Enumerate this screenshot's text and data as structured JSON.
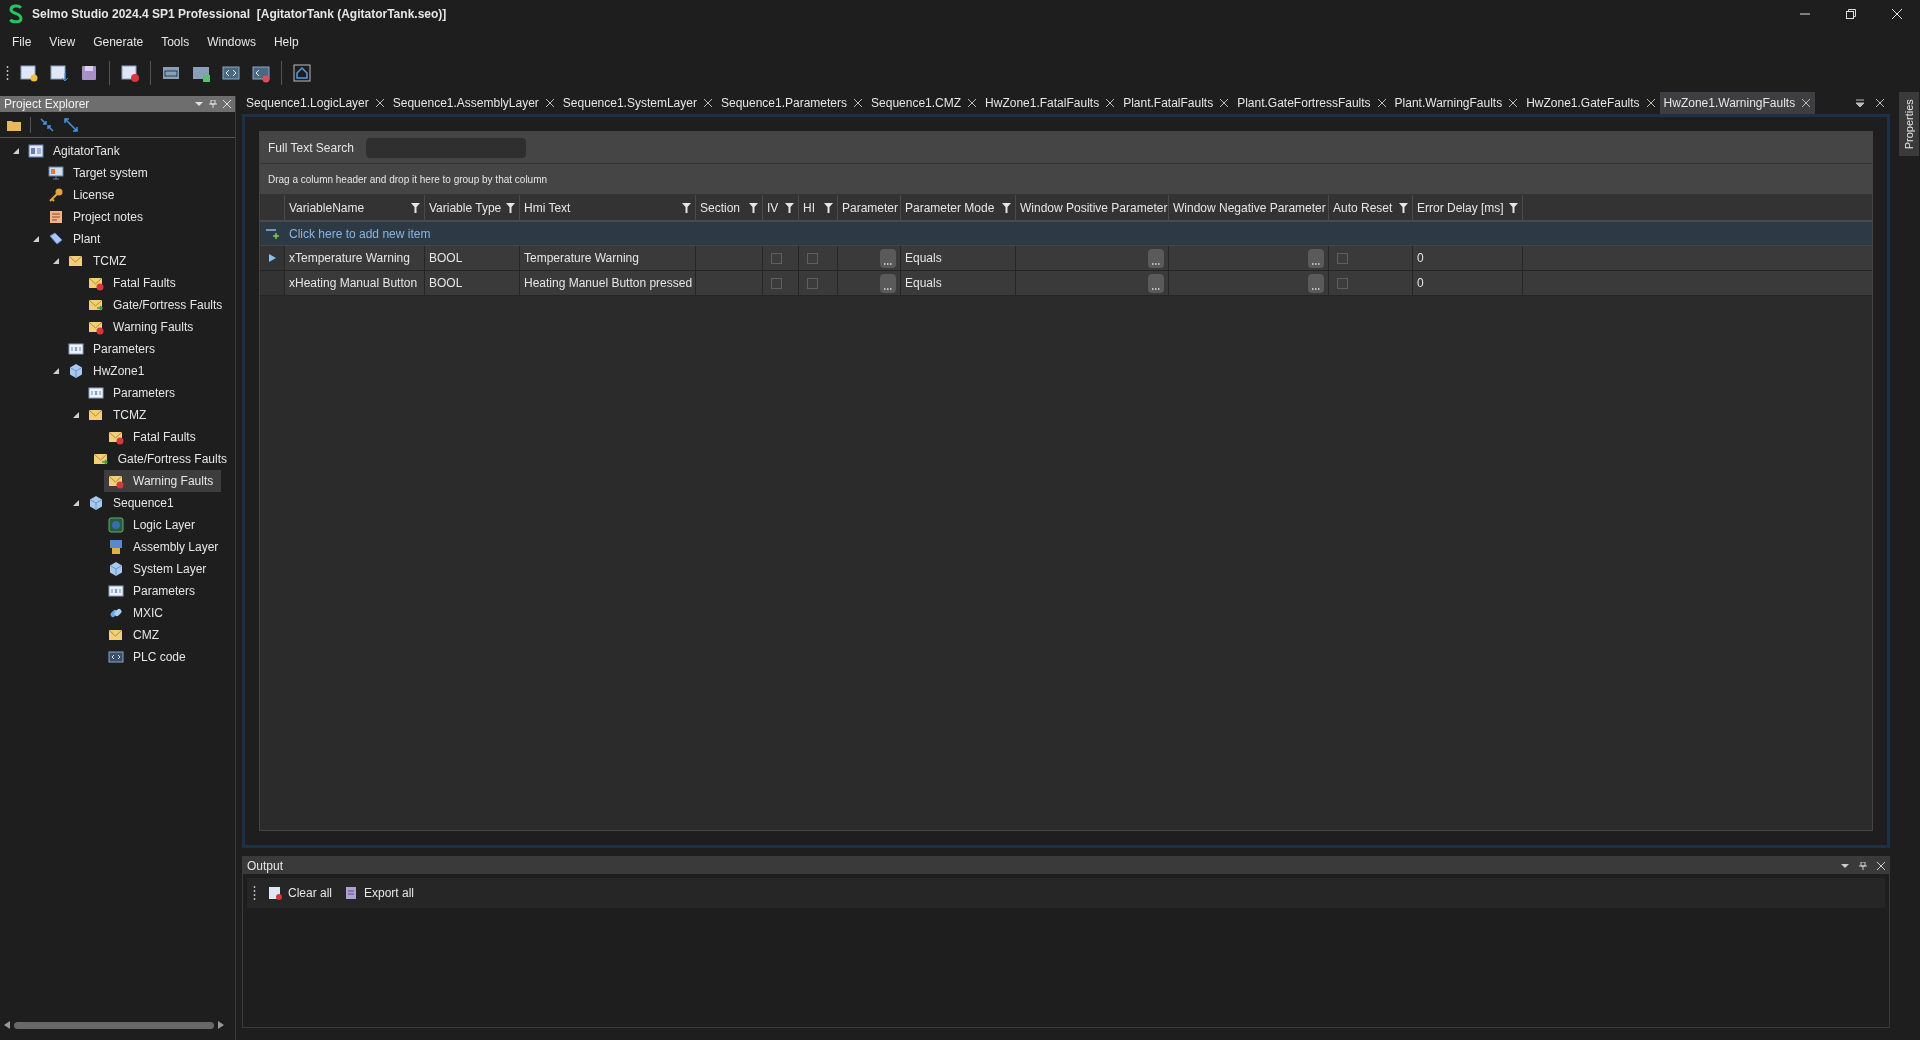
{
  "window": {
    "title": "Selmo Studio 2024.4 SP1 Professional  [AgitatorTank (AgitatorTank.seo)]"
  },
  "menu": [
    "File",
    "View",
    "Generate",
    "Tools",
    "Windows",
    "Help"
  ],
  "project_explorer": {
    "title": "Project Explorer",
    "tree": [
      {
        "label": "AgitatorTank",
        "kind": "project",
        "expanded": true,
        "selected": false,
        "children": [
          {
            "label": "Target system",
            "kind": "monitor",
            "selected": false
          },
          {
            "label": "License",
            "kind": "key",
            "selected": false
          },
          {
            "label": "Project notes",
            "kind": "notes",
            "selected": false
          },
          {
            "label": "Plant",
            "kind": "plant",
            "expanded": true,
            "selected": false,
            "children": [
              {
                "label": "TCMZ",
                "kind": "folder",
                "expanded": true,
                "selected": false,
                "children": [
                  {
                    "label": "Fatal Faults",
                    "kind": "fatal",
                    "selected": false
                  },
                  {
                    "label": "Gate/Fortress Faults",
                    "kind": "gate",
                    "selected": false
                  },
                  {
                    "label": "Warning Faults",
                    "kind": "warning",
                    "selected": false
                  }
                ]
              },
              {
                "label": "Parameters",
                "kind": "params",
                "selected": false
              },
              {
                "label": "HwZone1",
                "kind": "zone",
                "expanded": true,
                "selected": false,
                "children": [
                  {
                    "label": "Parameters",
                    "kind": "params",
                    "selected": false
                  },
                  {
                    "label": "TCMZ",
                    "kind": "folder",
                    "expanded": true,
                    "selected": false,
                    "children": [
                      {
                        "label": "Fatal Faults",
                        "kind": "fatal",
                        "selected": false
                      },
                      {
                        "label": "Gate/Fortress Faults",
                        "kind": "gate",
                        "selected": false
                      },
                      {
                        "label": "Warning Faults",
                        "kind": "warning",
                        "selected": true
                      }
                    ]
                  },
                  {
                    "label": "Sequence1",
                    "kind": "cube",
                    "expanded": true,
                    "selected": false,
                    "children": [
                      {
                        "label": "Logic Layer",
                        "kind": "logic",
                        "selected": false
                      },
                      {
                        "label": "Assembly Layer",
                        "kind": "assembly",
                        "selected": false
                      },
                      {
                        "label": "System Layer",
                        "kind": "cube",
                        "selected": false
                      },
                      {
                        "label": "Parameters",
                        "kind": "params",
                        "selected": false
                      },
                      {
                        "label": "MXIC",
                        "kind": "mxic",
                        "selected": false
                      },
                      {
                        "label": "CMZ",
                        "kind": "folder",
                        "selected": false
                      },
                      {
                        "label": "PLC code",
                        "kind": "code",
                        "selected": false
                      }
                    ]
                  }
                ]
              }
            ]
          }
        ]
      }
    ]
  },
  "tabs": [
    {
      "label": "Sequence1.LogicLayer",
      "selected": false
    },
    {
      "label": "Sequence1.AssemblyLayer",
      "selected": false
    },
    {
      "label": "Sequence1.SystemLayer",
      "selected": false
    },
    {
      "label": "Sequence1.Parameters",
      "selected": false
    },
    {
      "label": "Sequence1.CMZ",
      "selected": false
    },
    {
      "label": "HwZone1.FatalFaults",
      "selected": false
    },
    {
      "label": "Plant.FatalFaults",
      "selected": false
    },
    {
      "label": "Plant.GateFortressFaults",
      "selected": false
    },
    {
      "label": "Plant.WarningFaults",
      "selected": false
    },
    {
      "label": "HwZone1.GateFaults",
      "selected": false
    },
    {
      "label": "HwZone1.WarningFaults",
      "selected": true
    }
  ],
  "search": {
    "label": "Full Text Search"
  },
  "group_hint": "Drag a column header and drop it here to group by that column",
  "table": {
    "columns": [
      {
        "label": "VariableName",
        "filter": true
      },
      {
        "label": "Variable Type",
        "filter": true
      },
      {
        "label": "Hmi Text",
        "filter": true
      },
      {
        "label": "Section",
        "filter": true
      },
      {
        "label": "IV",
        "filter": true
      },
      {
        "label": "HI",
        "filter": true
      },
      {
        "label": "Parameter",
        "filter": false
      },
      {
        "label": "Parameter Mode",
        "filter": true
      },
      {
        "label": "Window Positive Parameter",
        "filter": false
      },
      {
        "label": "Window Negative Parameter",
        "filter": false
      },
      {
        "label": "Auto Reset",
        "filter": true
      },
      {
        "label": "Error Delay [ms]",
        "filter": true
      }
    ],
    "new_item": "Click here to add new item",
    "rows": [
      {
        "current": true,
        "cells": [
          {
            "kind": "text",
            "text": "xTemperature Warning"
          },
          {
            "kind": "text",
            "text": "BOOL"
          },
          {
            "kind": "text",
            "text": "Temperature Warning"
          },
          {
            "kind": "text"
          },
          {
            "kind": "check",
            "checked": false
          },
          {
            "kind": "check",
            "checked": false
          },
          {
            "kind": "more"
          },
          {
            "kind": "text",
            "text": "Equals"
          },
          {
            "kind": "more"
          },
          {
            "kind": "more"
          },
          {
            "kind": "check",
            "checked": false
          },
          {
            "kind": "text",
            "text": "0"
          }
        ]
      },
      {
        "current": false,
        "cells": [
          {
            "kind": "text",
            "text": "xHeating Manual Button"
          },
          {
            "kind": "text",
            "text": "BOOL"
          },
          {
            "kind": "text",
            "text": "Heating Manuel Button pressed"
          },
          {
            "kind": "text"
          },
          {
            "kind": "check",
            "checked": false
          },
          {
            "kind": "check",
            "checked": false
          },
          {
            "kind": "more"
          },
          {
            "kind": "text",
            "text": "Equals"
          },
          {
            "kind": "more"
          },
          {
            "kind": "more"
          },
          {
            "kind": "check",
            "checked": false
          },
          {
            "kind": "text",
            "text": "0"
          }
        ]
      }
    ]
  },
  "output": {
    "title": "Output",
    "buttons": [
      "Clear all",
      "Export all"
    ]
  },
  "properties_tab": "Properties"
}
